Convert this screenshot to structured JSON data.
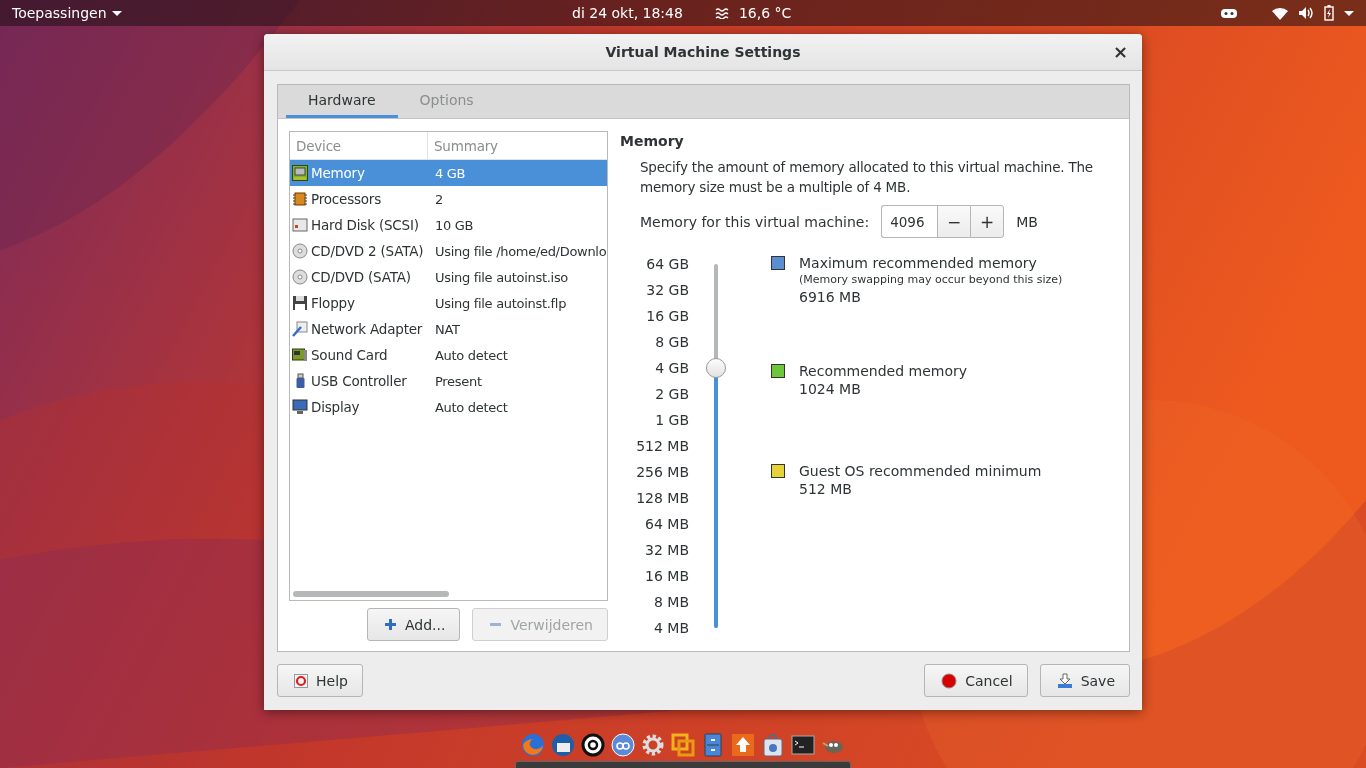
{
  "top_bar": {
    "menu": "Toepassingen",
    "clock": "di 24 okt, 18:48",
    "weather": "16,6 °C"
  },
  "window": {
    "title": "Virtual Machine Settings",
    "close": "×"
  },
  "tabs": [
    {
      "label": "Hardware",
      "selected": true
    },
    {
      "label": "Options",
      "selected": false
    }
  ],
  "device_list": {
    "columns": [
      "Device",
      "Summary"
    ],
    "rows": [
      {
        "kind": "memory",
        "device": "Memory",
        "summary": "4 GB",
        "selected": true
      },
      {
        "kind": "processor",
        "device": "Processors",
        "summary": "2",
        "selected": false
      },
      {
        "kind": "disk",
        "device": "Hard Disk (SCSI)",
        "summary": "10 GB",
        "selected": false
      },
      {
        "kind": "cd",
        "device": "CD/DVD 2 (SATA)",
        "summary": "Using file /home/ed/Downlo",
        "selected": false
      },
      {
        "kind": "cd",
        "device": "CD/DVD (SATA)",
        "summary": "Using file autoinst.iso",
        "selected": false
      },
      {
        "kind": "floppy",
        "device": "Floppy",
        "summary": "Using file autoinst.flp",
        "selected": false
      },
      {
        "kind": "network",
        "device": "Network Adapter",
        "summary": "NAT",
        "selected": false
      },
      {
        "kind": "sound",
        "device": "Sound Card",
        "summary": "Auto detect",
        "selected": false
      },
      {
        "kind": "usb",
        "device": "USB Controller",
        "summary": "Present",
        "selected": false
      },
      {
        "kind": "display",
        "device": "Display",
        "summary": "Auto detect",
        "selected": false
      }
    ]
  },
  "list_buttons": [
    {
      "kind": "add",
      "label": "Add...",
      "disabled": false
    },
    {
      "kind": "remove",
      "label": "Verwijderen",
      "disabled": true
    }
  ],
  "memory": {
    "heading": "Memory",
    "description": "Specify the amount of memory allocated to this virtual machine. The memory size must be a multiple of 4 MB.",
    "field_label": "Memory for this virtual machine:",
    "value": "4096",
    "minus": "−",
    "plus": "+",
    "unit": "MB",
    "scale": [
      "64 GB",
      "32 GB",
      "16 GB",
      "8 GB",
      "4 GB",
      "2 GB",
      "1 GB",
      "512 MB",
      "256 MB",
      "128 MB",
      "64 MB",
      "32 MB",
      "16 MB",
      "8 MB",
      "4 MB"
    ],
    "level": 0.714,
    "legend": [
      {
        "label": "Maximum recommended memory",
        "note": "(Memory swapping may occur beyond this size)",
        "value": "6916 MB",
        "color": "#5b8dd0"
      },
      {
        "label": "Recommended memory",
        "value": "1024 MB",
        "color": "#6cc73a"
      },
      {
        "label": "Guest OS recommended minimum",
        "value": "512 MB",
        "color": "#e8d23a"
      }
    ]
  },
  "footer_buttons": [
    {
      "kind": "help",
      "label": "Help"
    },
    {
      "kind": "cancel",
      "label": "Cancel"
    },
    {
      "kind": "save",
      "label": "Save"
    }
  ],
  "dock": [
    {
      "kind": "firefox"
    },
    {
      "kind": "thunderbird"
    },
    {
      "kind": "circle-a"
    },
    {
      "kind": "qb"
    },
    {
      "kind": "gear"
    },
    {
      "kind": "vm"
    },
    {
      "kind": "cabinet"
    },
    {
      "kind": "updater"
    },
    {
      "kind": "package"
    },
    {
      "kind": "terminal"
    },
    {
      "kind": "gimp"
    }
  ]
}
